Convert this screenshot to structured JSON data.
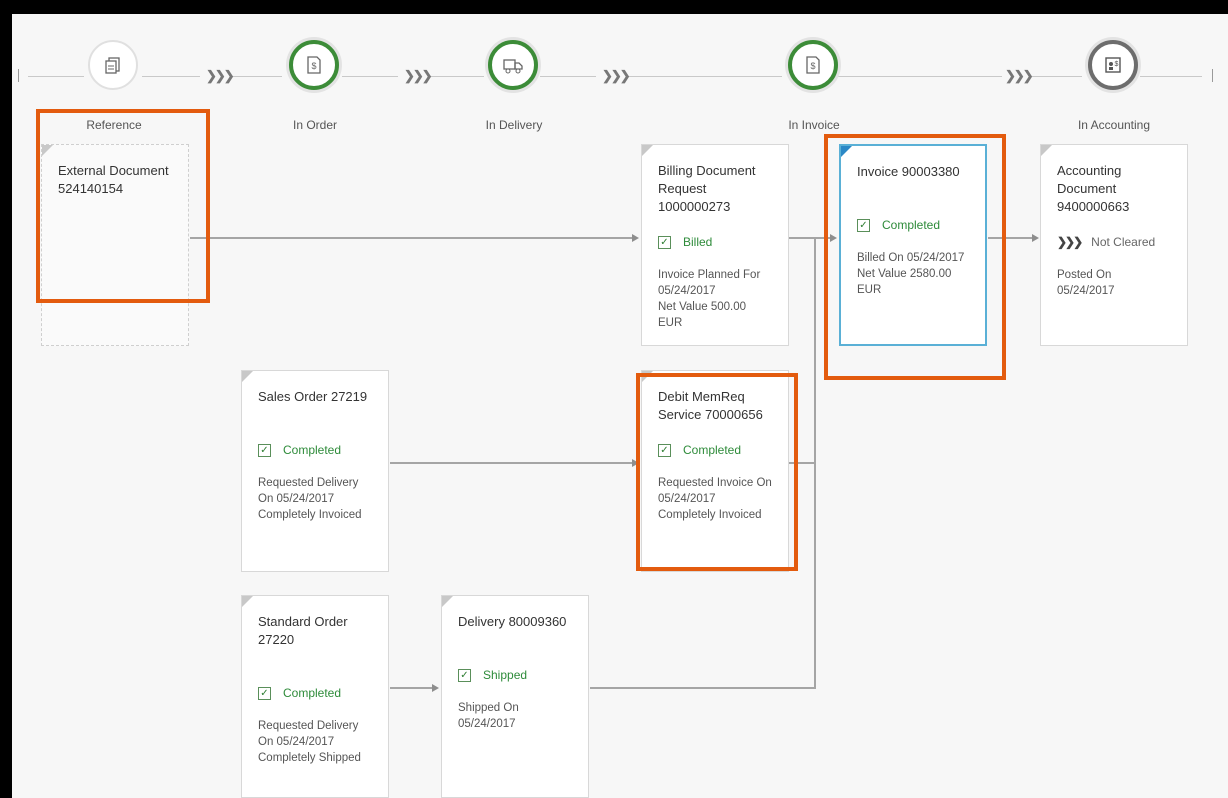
{
  "stages": [
    {
      "label": "Reference",
      "icon": "document-copy-icon"
    },
    {
      "label": "In Order",
      "icon": "order-document-icon"
    },
    {
      "label": "In Delivery",
      "icon": "truck-icon"
    },
    {
      "label": "In Invoice",
      "icon": "invoice-document-icon"
    },
    {
      "label": "In Accounting",
      "icon": "accounting-document-icon"
    }
  ],
  "nodes": {
    "external": {
      "title": "External Document 524140154"
    },
    "billing": {
      "title": "Billing Document Request 1000000273",
      "status": "Billed",
      "d1": "Invoice Planned For 05/24/2017",
      "d2": "Net Value 500.00 EUR"
    },
    "invoice": {
      "title": "Invoice 90003380",
      "status": "Completed",
      "d1": "Billed On 05/24/2017",
      "d2": "Net Value 2580.00 EUR"
    },
    "accounting": {
      "title": "Accounting Document 9400000663",
      "status": "Not Cleared",
      "d1": "Posted On 05/24/2017"
    },
    "sales": {
      "title": "Sales Order 27219",
      "status": "Completed",
      "d1": "Requested Delivery On 05/24/2017",
      "d2": "Completely Invoiced"
    },
    "debit": {
      "title": "Debit MemReq Service 70000656",
      "status": "Completed",
      "d1": "Requested Invoice On 05/24/2017",
      "d2": "Completely Invoiced"
    },
    "standard": {
      "title": "Standard Order 27220",
      "status": "Completed",
      "d1": "Requested Delivery On 05/24/2017",
      "d2": "Completely Shipped"
    },
    "delivery": {
      "title": "Delivery 80009360",
      "status": "Shipped",
      "d1": "Shipped On 05/24/2017"
    }
  },
  "colors": {
    "status_green": "#2e8b3a",
    "highlight": "#e35b0e",
    "selected_border": "#5ab0d6",
    "stage_green": "#3c8c38"
  }
}
